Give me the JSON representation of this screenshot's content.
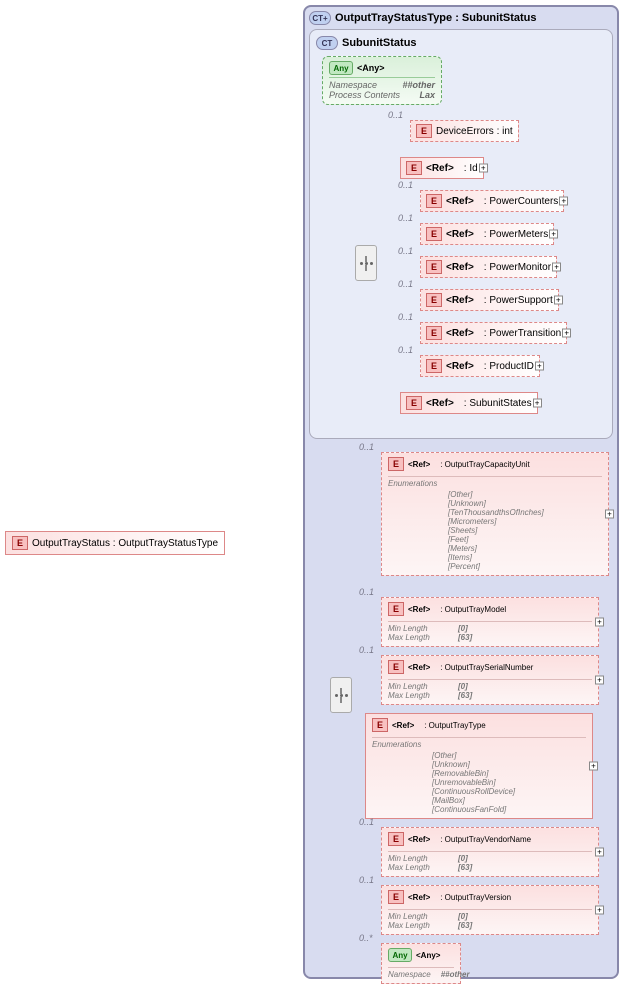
{
  "root": {
    "label": "OutputTrayStatus : OutputTrayStatusType"
  },
  "outer_ct": {
    "title": "OutputTrayStatusType : SubunitStatus"
  },
  "inner_ct": {
    "title": "SubunitStatus",
    "any": {
      "label": "<Any>",
      "ns_k": "Namespace",
      "ns_v": "##other",
      "pc_k": "Process Contents",
      "pc_v": "Lax"
    },
    "items": [
      {
        "card": "0..1",
        "ref": false,
        "label": "DeviceErrors : int",
        "dashed": true
      },
      {
        "card": "",
        "ref": true,
        "label": ": Id",
        "expand": true
      },
      {
        "card": "0..1",
        "ref": true,
        "label": ": PowerCounters",
        "dashed": true,
        "expand": true
      },
      {
        "card": "0..1",
        "ref": true,
        "label": ": PowerMeters",
        "dashed": true,
        "expand": true
      },
      {
        "card": "0..1",
        "ref": true,
        "label": ": PowerMonitor",
        "dashed": true,
        "expand": true
      },
      {
        "card": "0..1",
        "ref": true,
        "label": ": PowerSupport",
        "dashed": true,
        "expand": true
      },
      {
        "card": "0..1",
        "ref": true,
        "label": ": PowerTransition",
        "dashed": true,
        "expand": true
      },
      {
        "card": "0..1",
        "ref": true,
        "label": ": ProductID",
        "dashed": true,
        "expand": true
      },
      {
        "card": "",
        "ref": true,
        "label": ": SubunitStates",
        "expand": true
      }
    ]
  },
  "outer_items": [
    {
      "card": "0..1",
      "ref": true,
      "label": ": OutputTrayCapacityUnit",
      "dashed": true,
      "expand": true,
      "constraints": {
        "type": "enum",
        "title": "Enumerations",
        "values": [
          "[Other]",
          "[Unknown]",
          "[TenThousandthsOfInches]",
          "[Micrometers]",
          "[Sheets]",
          "[Feet]",
          "[Meters]",
          "[Items]",
          "[Percent]"
        ]
      }
    },
    {
      "card": "0..1",
      "ref": true,
      "label": ": OutputTrayModel",
      "dashed": true,
      "expand": true,
      "constraints": {
        "type": "len",
        "rows": [
          [
            "Min Length",
            "[0]"
          ],
          [
            "Max Length",
            "[63]"
          ]
        ]
      }
    },
    {
      "card": "0..1",
      "ref": true,
      "label": ": OutputTraySerialNumber",
      "dashed": true,
      "expand": true,
      "constraints": {
        "type": "len",
        "rows": [
          [
            "Min Length",
            "[0]"
          ],
          [
            "Max Length",
            "[63]"
          ]
        ]
      }
    },
    {
      "card": "",
      "ref": true,
      "label": ": OutputTrayType",
      "expand": true,
      "constraints": {
        "type": "enum",
        "title": "Enumerations",
        "values": [
          "[Other]",
          "[Unknown]",
          "[RemovableBin]",
          "[UnremovableBin]",
          "[ContinuousRollDevice]",
          "[MailBox]",
          "[ContinuousFanFold]"
        ]
      }
    },
    {
      "card": "0..1",
      "ref": true,
      "label": ": OutputTrayVendorName",
      "dashed": true,
      "expand": true,
      "constraints": {
        "type": "len",
        "rows": [
          [
            "Min Length",
            "[0]"
          ],
          [
            "Max Length",
            "[63]"
          ]
        ]
      }
    },
    {
      "card": "0..1",
      "ref": true,
      "label": ": OutputTrayVersion",
      "dashed": true,
      "expand": true,
      "constraints": {
        "type": "len",
        "rows": [
          [
            "Min Length",
            "[0]"
          ],
          [
            "Max Length",
            "[63]"
          ]
        ]
      }
    },
    {
      "card": "0..*",
      "any": true,
      "label": "<Any>",
      "constraints": {
        "type": "ns",
        "rows": [
          [
            "Namespace",
            "##other"
          ]
        ]
      }
    }
  ]
}
